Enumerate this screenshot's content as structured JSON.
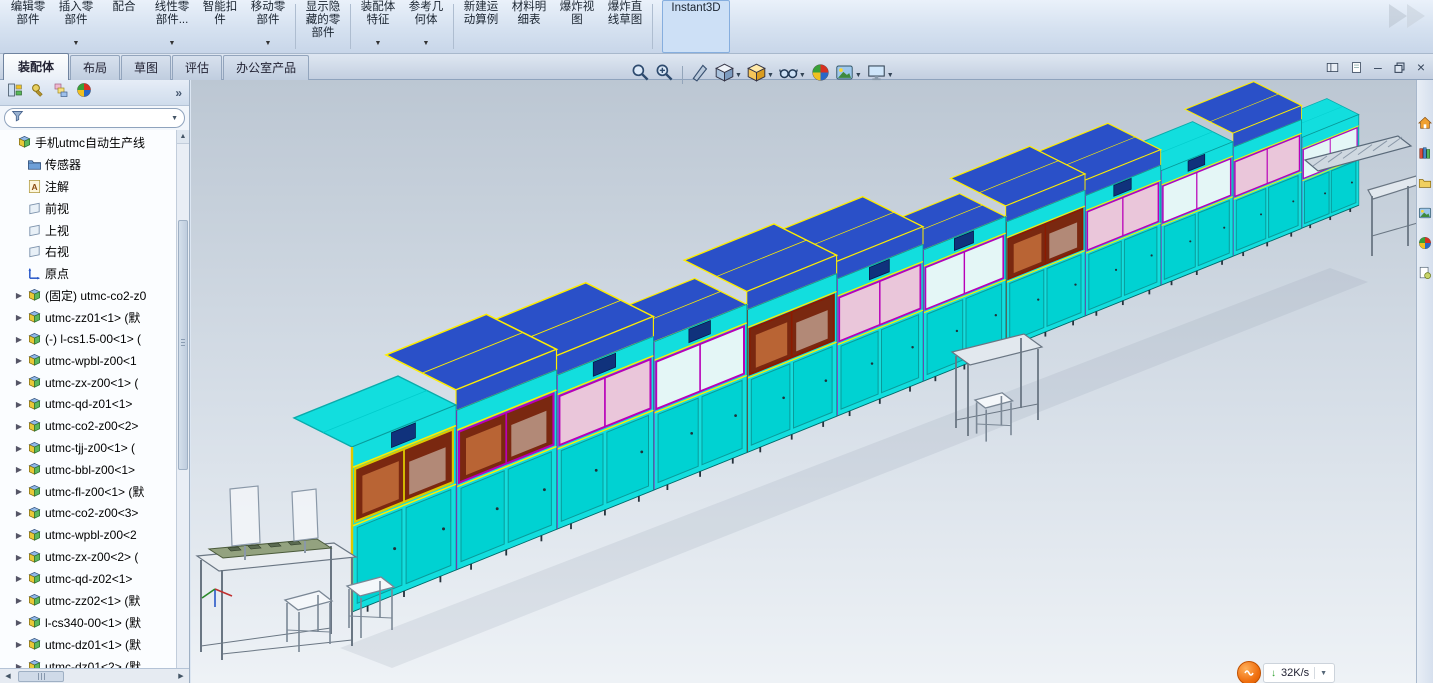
{
  "glyphs": {
    "menu_arrow": "▼",
    "overflow": "»",
    "left": "◀",
    "right": "▶",
    "up": "▲",
    "minimize": "–",
    "close": "×",
    "badge_arrow": "↓",
    "badge_menu": "▼"
  },
  "command_bar": {
    "buttons": [
      {
        "label": "编辑零部件"
      },
      {
        "label": "插入零部件",
        "menu": true
      },
      {
        "label": "配合"
      },
      {
        "label": "线性零部件...",
        "menu": true
      },
      {
        "label": "智能扣件"
      },
      {
        "label": "移动零部件",
        "menu": true,
        "group_end": true
      },
      {
        "label": "显示隐藏的零部件",
        "group_end": true
      },
      {
        "label": "装配体特征",
        "menu": true
      },
      {
        "label": "参考几何体",
        "menu": true,
        "group_end": true
      },
      {
        "label": "新建运动算例"
      },
      {
        "label": "材料明细表"
      },
      {
        "label": "爆炸视图"
      },
      {
        "label": "爆炸直线草图",
        "group_end": true
      },
      {
        "label": "Instant3D",
        "active": true,
        "wide": true
      }
    ]
  },
  "document_tabs": [
    {
      "label": "装配体",
      "active": true
    },
    {
      "label": "布局"
    },
    {
      "label": "草图"
    },
    {
      "label": "评估"
    },
    {
      "label": "办公室产品"
    }
  ],
  "feature_panel": {
    "tab_icons": [
      "featuremanager-tab",
      "propertymanager-tab",
      "configurationmanager-tab",
      "appearances-tab"
    ],
    "root": {
      "label": "手机utmc自动生产线"
    },
    "items": [
      {
        "label": "传感器",
        "icon": "folder"
      },
      {
        "label": "注解",
        "icon": "annotations"
      },
      {
        "label": "前视",
        "icon": "plane"
      },
      {
        "label": "上视",
        "icon": "plane"
      },
      {
        "label": "右视",
        "icon": "plane"
      },
      {
        "label": "原点",
        "icon": "origin"
      },
      {
        "label": "(固定) utmc-co2-z0",
        "icon": "component",
        "exp": true
      },
      {
        "label": "utmc-zz01<1> (默",
        "icon": "component",
        "exp": true
      },
      {
        "label": "(-) l-cs1.5-00<1> (",
        "icon": "component",
        "exp": true
      },
      {
        "label": "utmc-wpbl-z00<1",
        "icon": "component",
        "exp": true
      },
      {
        "label": "utmc-zx-z00<1> (",
        "icon": "component",
        "exp": true
      },
      {
        "label": "utmc-qd-z01<1>",
        "icon": "component",
        "exp": true
      },
      {
        "label": "utmc-co2-z00<2>",
        "icon": "component",
        "exp": true
      },
      {
        "label": "utmc-tjj-z00<1> (",
        "icon": "component",
        "exp": true
      },
      {
        "label": "utmc-bbl-z00<1>",
        "icon": "component",
        "exp": true
      },
      {
        "label": "utmc-fl-z00<1> (默",
        "icon": "component",
        "exp": true
      },
      {
        "label": "utmc-co2-z00<3>",
        "icon": "component",
        "exp": true
      },
      {
        "label": "utmc-wpbl-z00<2",
        "icon": "component",
        "exp": true
      },
      {
        "label": "utmc-zx-z00<2> (",
        "icon": "component",
        "exp": true
      },
      {
        "label": "utmc-qd-z02<1>",
        "icon": "component",
        "exp": true
      },
      {
        "label": "utmc-zz02<1> (默",
        "icon": "component",
        "exp": true
      },
      {
        "label": "l-cs340-00<1> (默",
        "icon": "component",
        "exp": true
      },
      {
        "label": "utmc-dz01<1> (默",
        "icon": "component",
        "exp": true
      },
      {
        "label": "utmc-dz01<2> (默",
        "icon": "component",
        "exp": true
      }
    ]
  },
  "headsup": {
    "buttons": [
      {
        "name": "zoom-fit",
        "icon": "magnifier"
      },
      {
        "name": "zoom-area",
        "icon": "magnifier_plus",
        "sep_after": true
      },
      {
        "name": "section-view",
        "icon": "knife"
      },
      {
        "name": "view-orientation",
        "icon": "cube_view",
        "menu": true
      },
      {
        "name": "display-style",
        "icon": "cube_style",
        "menu": true
      },
      {
        "name": "hide-show-items",
        "icon": "glasses",
        "menu": true
      },
      {
        "name": "edit-appearance",
        "icon": "ball"
      },
      {
        "name": "apply-scene",
        "icon": "scene",
        "menu": true
      },
      {
        "name": "view-settings",
        "icon": "monitor",
        "menu": true
      }
    ]
  },
  "task_pane": {
    "icons": [
      "resources",
      "design-library",
      "file-explorer",
      "view-palette",
      "appearances",
      "custom-properties"
    ]
  },
  "window": {
    "controls": [
      "panes",
      "sheet",
      "minimize",
      "restore",
      "close"
    ]
  },
  "status_overlay": {
    "speed": "32K/s"
  },
  "scene": {
    "colors": {
      "bg_top": "#bcc7d3",
      "bg_mid": "#d7dfe8",
      "bg_bottom": "#eef2f6",
      "cyan": "#12dede",
      "cyan_dark": "#0aa0a0",
      "door": "#00d2d2",
      "top_blue": "#2a50c8",
      "yellow": "#ffee00",
      "magenta": "#b800b8",
      "red_frame": "#8c1a00",
      "interior": "#7a2810",
      "pink": "#eac6da",
      "white_win": "#e4f6f6"
    }
  }
}
